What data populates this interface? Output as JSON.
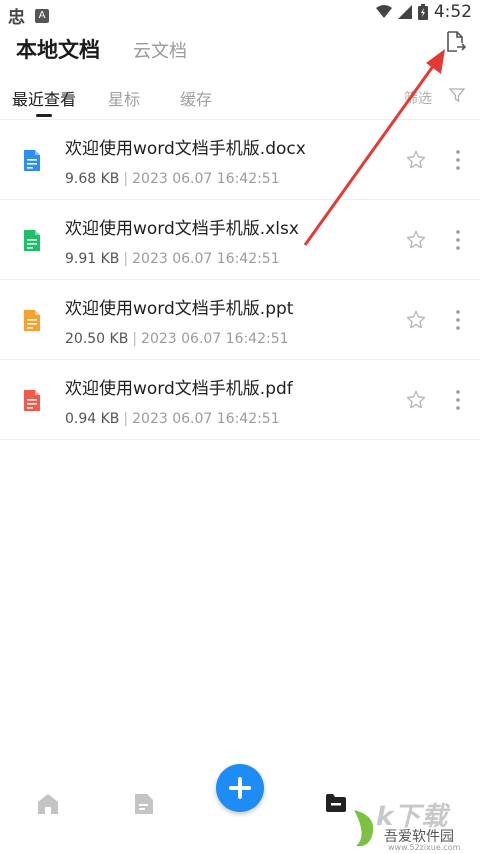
{
  "status_bar": {
    "app_glyph": "忠",
    "notif_glyph": "A",
    "time": "4:52"
  },
  "header": {
    "tabs": [
      {
        "label": "本地文档",
        "active": true
      },
      {
        "label": "云文档",
        "active": false
      }
    ],
    "import_icon": "file-import-icon"
  },
  "subtabs": {
    "items": [
      {
        "label": "最近查看",
        "active": true
      },
      {
        "label": "星标",
        "active": false
      },
      {
        "label": "缓存",
        "active": false
      }
    ],
    "filter_label": "筛选"
  },
  "files": [
    {
      "name": "欢迎使用word文档手机版.docx",
      "size": "9.68 KB",
      "sep": "|",
      "date": "2023 06.07 16:42:51",
      "type": "word",
      "color": "#2f8ff0"
    },
    {
      "name": "欢迎使用word文档手机版.xlsx",
      "size": "9.91 KB",
      "sep": "|",
      "date": "2023 06.07 16:42:51",
      "type": "excel",
      "color": "#1fbf6a"
    },
    {
      "name": "欢迎使用word文档手机版.ppt",
      "size": "20.50 KB",
      "sep": "|",
      "date": "2023 06.07 16:42:51",
      "type": "ppt",
      "color": "#f5a030"
    },
    {
      "name": "欢迎使用word文档手机版.pdf",
      "size": "0.94 KB",
      "sep": "|",
      "date": "2023 06.07 16:42:51",
      "type": "pdf",
      "color": "#f05a4a"
    }
  ],
  "watermark": {
    "big": "k下载",
    "name": "吾爱软件园",
    "url": "www.52zixue.com"
  },
  "colors": {
    "accent": "#1e8cf5",
    "arrow": "#e53935"
  }
}
